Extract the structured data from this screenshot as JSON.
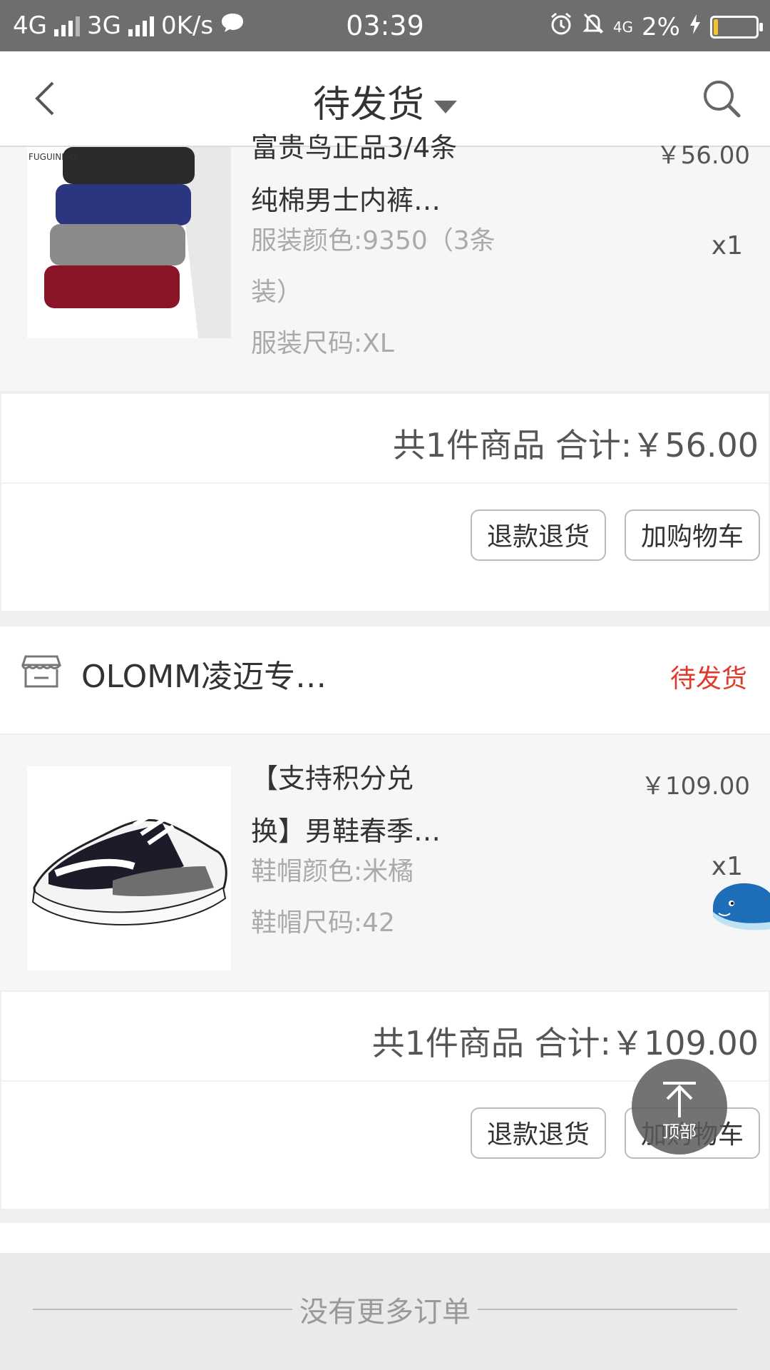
{
  "statusbar": {
    "net1": "4G",
    "net2": "3G",
    "speed": "0K/s",
    "time": "03:39",
    "net3": "4G",
    "battery": "2%"
  },
  "navbar": {
    "title": "待发货"
  },
  "order1": {
    "product_name_line0": "富贵鸟正品3/4条",
    "product_name_line1": "纯棉男士内裤…",
    "price": "￥56.00",
    "attr_color": "服装颜色:9350（3条",
    "attr_color_cont": "装）",
    "attr_size": "服装尺码:XL",
    "qty": "x1",
    "total": "共1件商品  合计:￥56.00",
    "btn_refund": "退款退货",
    "btn_cart": "加购物车"
  },
  "order2": {
    "shop_name": "OLOMM凌迈专…",
    "status": "待发货",
    "product_name_line1": "【支持积分兑",
    "product_name_line2": "换】男鞋春季…",
    "price": "￥109.00",
    "attr_color": "鞋帽颜色:米橘",
    "attr_size": "鞋帽尺码:42",
    "qty": "x1",
    "total": "共1件商品  合计:￥109.00",
    "btn_refund": "退款退货",
    "btn_cart": "加购物车"
  },
  "footer": {
    "text": "没有更多订单"
  },
  "gotop": {
    "label": "顶部"
  }
}
